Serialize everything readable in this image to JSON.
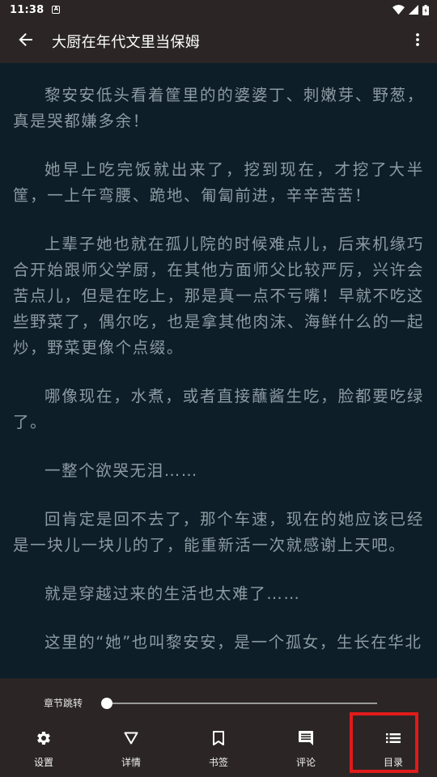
{
  "status_bar": {
    "time": "11:38",
    "notification_icon": "a-notification-icon",
    "icons": [
      "wifi-icon",
      "signal-icon",
      "battery-icon"
    ]
  },
  "app_bar": {
    "title": "大厨在年代文里当保姆",
    "back_icon": "arrow-back-icon",
    "more_icon": "more-vert-icon"
  },
  "content": {
    "paragraphs": [
      "黎安安低头看着筐里的的婆婆丁、刺嫩芽、野葱，真是哭都嫌多余！",
      "她早上吃完饭就出来了，挖到现在，才挖了大半筐，一上午弯腰、跪地、匍匐前进，辛辛苦苦！",
      "上辈子她也就在孤儿院的时候难点儿，后来机缘巧合开始跟师父学厨，在其他方面师父比较严厉，兴许会苦点儿，但是在吃上，那是真一点不亏嘴！早就不吃这些野菜了，偶尔吃，也是拿其他肉沫、海鲜什么的一起炒，野菜更像个点缀。",
      "哪像现在，水煮，或者直接蘸酱生吃，脸都要吃绿了。",
      "一整个欲哭无泪……",
      "回肯定是回不去了，那个车速，现在的她应该已经是一块儿一块儿的了，能重新活一次就感谢上天吧。",
      "就是穿越过来的生活也太难了……",
      "这里的“她”也叫黎安安，是一个孤女，生长在华北"
    ]
  },
  "bottom_panel": {
    "chapter_jump_label": "章节跳转",
    "chapter_progress": 0.0,
    "tabs": [
      {
        "label": "设置",
        "icon": "gear-icon"
      },
      {
        "label": "详情",
        "icon": "triangle-down-icon"
      },
      {
        "label": "书签",
        "icon": "bookmark-icon"
      },
      {
        "label": "评论",
        "icon": "comment-icon"
      },
      {
        "label": "目录",
        "icon": "list-icon"
      }
    ]
  },
  "colors": {
    "bar_background": "#2b2525",
    "reader_background": "#0d1e28",
    "reader_text": "#8d9aa2",
    "highlight": "#e01b1b"
  }
}
